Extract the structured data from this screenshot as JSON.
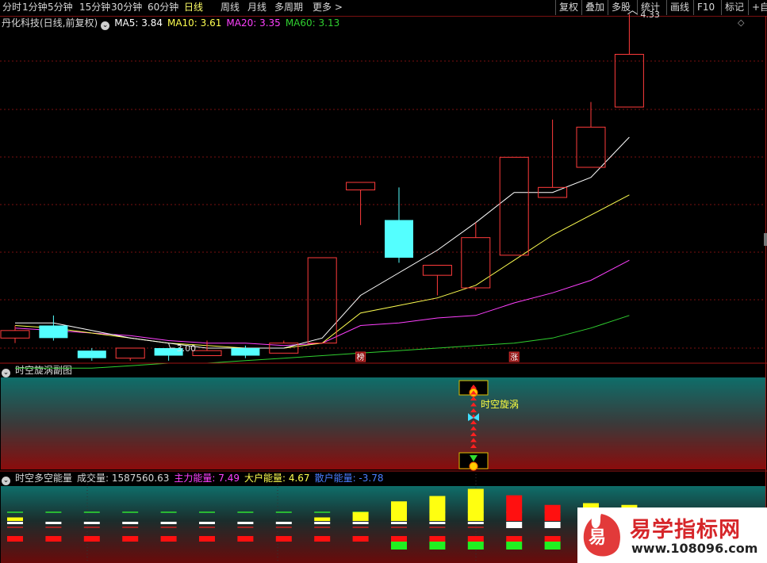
{
  "toolbar": {
    "periods": [
      "分时",
      "1分钟",
      "5分钟",
      "15分钟",
      "30分钟",
      "60分钟",
      "日线",
      "周线",
      "月线",
      "多周期",
      "更多"
    ],
    "active": "日线",
    "right_buttons": [
      "复权",
      "叠加",
      "多股",
      "统计",
      "画线",
      "F10",
      "标记",
      "+自"
    ]
  },
  "main_panel": {
    "stock_name": "丹化科技(日线,前复权)",
    "ma5_label": "MA5: 3.84",
    "ma10_label": "MA10: 3.61",
    "ma20_label": "MA20: 3.35",
    "ma60_label": "MA60: 3.13",
    "high_label": "4.33",
    "low_label": "3.00",
    "badge_left": "榜",
    "badge_right": "涨",
    "colors": {
      "up": "#ff3b3b",
      "down": "#54ffff",
      "ma5": "#ffffff",
      "ma10": "#ffff50",
      "ma20": "#ff40ff",
      "ma60": "#30d030"
    }
  },
  "candles": [
    {
      "o": 3.04,
      "c": 3.07,
      "h": 3.09,
      "l": 3.02
    },
    {
      "o": 3.09,
      "c": 3.04,
      "h": 3.13,
      "l": 3.03
    },
    {
      "o": 2.99,
      "c": 2.96,
      "h": 3.0,
      "l": 2.95
    },
    {
      "o": 2.96,
      "c": 3.0,
      "h": 3.0,
      "l": 2.95
    },
    {
      "o": 3.0,
      "c": 2.97,
      "h": 3.0,
      "l": 2.95
    },
    {
      "o": 2.97,
      "c": 2.99,
      "h": 3.03,
      "l": 2.97
    },
    {
      "o": 3.0,
      "c": 2.97,
      "h": 3.01,
      "l": 2.96
    },
    {
      "o": 2.98,
      "c": 3.02,
      "h": 3.03,
      "l": 2.98
    },
    {
      "o": 3.02,
      "c": 3.36,
      "h": 3.36,
      "l": 3.02
    },
    {
      "o": 3.63,
      "c": 3.66,
      "h": 3.66,
      "l": 3.49
    },
    {
      "o": 3.51,
      "c": 3.36,
      "h": 3.64,
      "l": 3.34
    },
    {
      "o": 3.29,
      "c": 3.33,
      "h": 3.33,
      "l": 3.21
    },
    {
      "o": 3.24,
      "c": 3.44,
      "h": 3.5,
      "l": 3.23
    },
    {
      "o": 3.37,
      "c": 3.76,
      "h": 3.76,
      "l": 3.37
    },
    {
      "o": 3.6,
      "c": 3.64,
      "h": 3.91,
      "l": 3.6
    },
    {
      "o": 3.72,
      "c": 3.88,
      "h": 3.98,
      "l": 3.72
    },
    {
      "o": 3.96,
      "c": 4.17,
      "h": 4.33,
      "l": 3.96
    }
  ],
  "ma_series": {
    "ma5": [
      3.1,
      3.1,
      3.07,
      3.04,
      3.02,
      3.0,
      3.0,
      3.0,
      3.04,
      3.21,
      3.3,
      3.39,
      3.5,
      3.62,
      3.62,
      3.68,
      3.84
    ],
    "ma10": [
      3.09,
      3.08,
      3.06,
      3.04,
      3.02,
      3.01,
      3.0,
      3.0,
      3.02,
      3.14,
      3.17,
      3.2,
      3.25,
      3.35,
      3.45,
      3.53,
      3.61
    ],
    "ma20": [
      3.08,
      3.07,
      3.06,
      3.05,
      3.03,
      3.02,
      3.02,
      3.01,
      3.02,
      3.09,
      3.1,
      3.12,
      3.13,
      3.18,
      3.22,
      3.27,
      3.35
    ],
    "ma60": [
      2.92,
      2.92,
      2.92,
      2.93,
      2.94,
      2.94,
      2.95,
      2.96,
      2.97,
      2.98,
      2.99,
      3.0,
      3.01,
      3.02,
      3.04,
      3.08,
      3.13
    ]
  },
  "sub_panel": {
    "title": "时空旋涡副图",
    "label": "时空旋涡"
  },
  "bottom_panel": {
    "title": "时空多空能量",
    "volume_label": "成交量: 1587560.63",
    "main_force_label": "主力能量: 7.49",
    "big_label": "大户能量: 4.67",
    "retail_label": "散户能量: -3.78",
    "bars": [
      {
        "yellow": 0.1,
        "red": 0
      },
      {
        "yellow": 0,
        "red": 0
      },
      {
        "yellow": 0,
        "red": 0
      },
      {
        "yellow": 0,
        "red": 0
      },
      {
        "yellow": 0,
        "red": 0
      },
      {
        "yellow": 0,
        "red": 0
      },
      {
        "yellow": 0,
        "red": 0
      },
      {
        "yellow": 0,
        "red": 0
      },
      {
        "yellow": 0.1,
        "red": 0
      },
      {
        "yellow": 0.25,
        "red": 0
      },
      {
        "yellow": 0.55,
        "red": 0
      },
      {
        "yellow": 0.7,
        "red": 0
      },
      {
        "yellow": 0.9,
        "red": 0
      },
      {
        "yellow": 0,
        "red": 0.72
      },
      {
        "yellow": 0,
        "red": 0.45
      },
      {
        "yellow": 0.5,
        "red": 0
      },
      {
        "yellow": 0.45,
        "red": 0
      }
    ]
  },
  "watermark": {
    "title": "易学指标网",
    "url": "www.108096.com",
    "glyph": "易"
  }
}
